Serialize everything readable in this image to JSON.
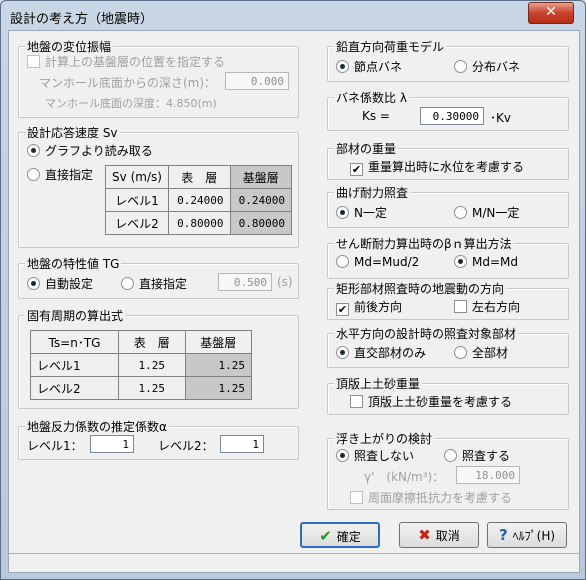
{
  "window": {
    "title": "設計の考え方（地震時）",
    "close": "✕"
  },
  "displacement": {
    "title": "地盤の変位振幅",
    "check_label": "計算上の基盤層の位置を指定する",
    "depth_label": "マンホール底面からの深さ(m)：",
    "depth_value": "0.000",
    "depth_info": "マンホール底面の深度：4.850(m)"
  },
  "velocity": {
    "title": "設計応答速度 Sv",
    "radio_graph": "グラフより読み取る",
    "radio_direct": "直接指定",
    "table": {
      "headers": [
        "Sv (m/s)",
        "表　層",
        "基盤層"
      ],
      "rows": [
        [
          "レベル1",
          "0.24000",
          "0.24000"
        ],
        [
          "レベル2",
          "0.80000",
          "0.80000"
        ]
      ]
    }
  },
  "tg": {
    "title": "地盤の特性値 TG",
    "radio_auto": "自動設定",
    "radio_direct": "直接指定",
    "value": "0.500",
    "unit": "(s)"
  },
  "period": {
    "title": "固有周期の算出式",
    "table": {
      "headers": [
        "Ts=n･TG",
        "表　層",
        "基盤層"
      ],
      "rows": [
        [
          "レベル1",
          "1.25",
          "1.25"
        ],
        [
          "レベル2",
          "1.25",
          "1.25"
        ]
      ]
    }
  },
  "reaction": {
    "title": "地盤反力係数の推定係数α",
    "level1_label": "レベル1：",
    "level1_value": "1",
    "level2_label": "レベル2：",
    "level2_value": "1"
  },
  "load_model": {
    "title": "鉛直方向荷重モデル",
    "opt1": "節点バネ",
    "opt2": "分布バネ"
  },
  "spring": {
    "title": "バネ係数比 λ",
    "label": "Ks =",
    "value": "0.30000",
    "suffix": "･Kv"
  },
  "weight": {
    "title": "部材の重量",
    "check_label": "重量算出時に水位を考慮する"
  },
  "bending": {
    "title": "曲げ耐力照査",
    "opt1": "N一定",
    "opt2": "M/N一定"
  },
  "shear": {
    "title": "せん断耐力算出時のβｎ算出方法",
    "opt1": "Md=Mud/2",
    "opt2": "Md=Md"
  },
  "direction": {
    "title": "矩形部材照査時の地震動の方向",
    "opt1": "前後方向",
    "opt2": "左右方向"
  },
  "horizontal": {
    "title": "水平方向の設計時の照査対象部材",
    "opt1": "直交部材のみ",
    "opt2": "全部材"
  },
  "topsoil": {
    "title": "頂版上土砂重量",
    "check_label": "頂版上土砂重量を考慮する"
  },
  "buoyancy": {
    "title": "浮き上がりの検討",
    "opt1": "照査しない",
    "opt2": "照査する",
    "gamma_label": "γ'　(kN/m³)：",
    "gamma_value": "18.000",
    "friction_label": "周面摩擦抵抗力を考慮する"
  },
  "buttons": {
    "ok": "確定",
    "cancel": "取消",
    "help": "ﾍﾙﾌﾟ(H)"
  },
  "colors": {
    "ok_icon": "#1e9a1e",
    "cancel_icon": "#c8201a",
    "help_icon": "#2a5fb0"
  }
}
